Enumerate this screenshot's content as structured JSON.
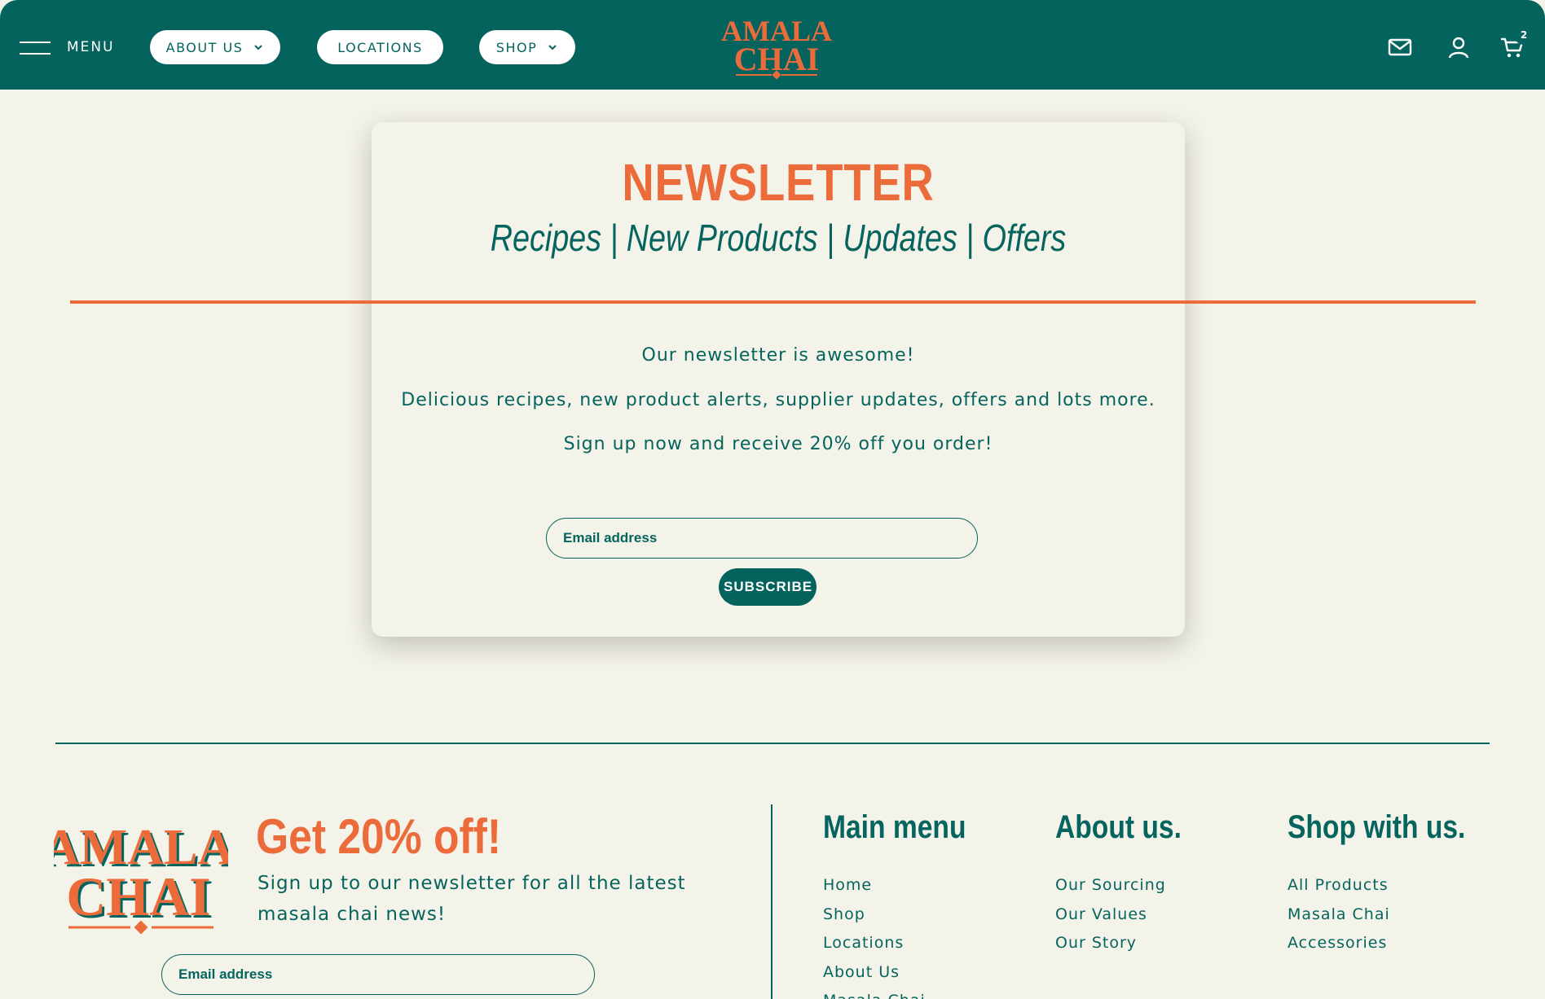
{
  "colors": {
    "brand_teal": "#04645d",
    "accent_orange": "#ec6b3b",
    "background": "#f4f3ea"
  },
  "header": {
    "menu_label": "MENU",
    "nav": [
      {
        "label": "ABOUT US",
        "has_dropdown": true
      },
      {
        "label": "LOCATIONS",
        "has_dropdown": false
      },
      {
        "label": "SHOP",
        "has_dropdown": true
      }
    ],
    "logo_text_top": "AMALA",
    "logo_text_bottom": "CHAI",
    "icons": [
      "mail-icon",
      "account-icon",
      "cart-icon"
    ],
    "cart_count": "2"
  },
  "newsletter": {
    "title": "NEWSLETTER",
    "subtitle": "Recipes | New Products | Updates | Offers",
    "line1": "Our newsletter is awesome!",
    "line2": "Delicious recipes, new product alerts, supplier updates, offers and lots more.",
    "line3": "Sign up now and receive 20% off you order!",
    "email_placeholder": "Email address",
    "subscribe_label": "SUBSCRIBE"
  },
  "footer": {
    "logo_text_top": "AMALA",
    "logo_text_bottom": "CHAI",
    "offer_heading": "Get 20% off!",
    "offer_text": "Sign up to our newsletter for all the latest masala chai news!",
    "email_placeholder": "Email address",
    "columns": [
      {
        "title": "Main menu",
        "links": [
          "Home",
          "Shop",
          "Locations",
          "About Us",
          "Masala Chai"
        ]
      },
      {
        "title": "About us.",
        "links": [
          "Our Sourcing",
          "Our Values",
          "Our Story"
        ]
      },
      {
        "title": "Shop with us.",
        "links": [
          "All Products",
          "Masala Chai",
          "Accessories"
        ]
      }
    ]
  }
}
